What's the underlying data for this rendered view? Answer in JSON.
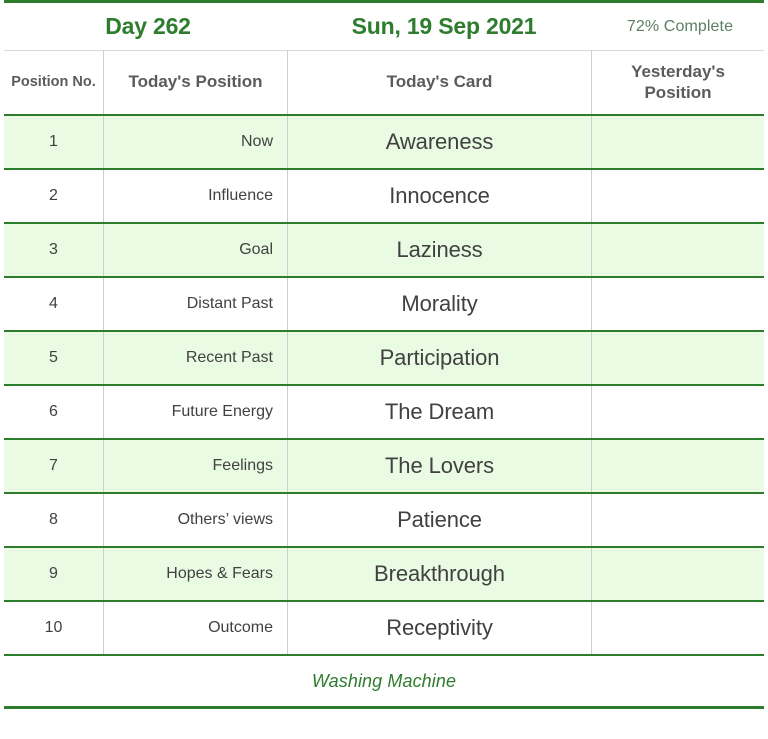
{
  "header": {
    "day_label": "Day 262",
    "date_label": "Sun, 19 Sep 2021",
    "progress_label": "72% Complete"
  },
  "table": {
    "columns": [
      {
        "key": "position_no",
        "label": "Position No."
      },
      {
        "key": "todays_position",
        "label": "Today's Position"
      },
      {
        "key": "todays_card",
        "label": "Today's Card"
      },
      {
        "key": "yesterdays_position",
        "label": "Yesterday's Position"
      }
    ],
    "rows": [
      {
        "no": "1",
        "position": "Now",
        "card": "Awareness",
        "yesterday": ""
      },
      {
        "no": "2",
        "position": "Influence",
        "card": "Innocence",
        "yesterday": ""
      },
      {
        "no": "3",
        "position": "Goal",
        "card": "Laziness",
        "yesterday": ""
      },
      {
        "no": "4",
        "position": "Distant Past",
        "card": "Morality",
        "yesterday": ""
      },
      {
        "no": "5",
        "position": "Recent Past",
        "card": "Participation",
        "yesterday": ""
      },
      {
        "no": "6",
        "position": "Future Energy",
        "card": "The Dream",
        "yesterday": ""
      },
      {
        "no": "7",
        "position": "Feelings",
        "card": "The Lovers",
        "yesterday": ""
      },
      {
        "no": "8",
        "position": "Others’ views",
        "card": "Patience",
        "yesterday": ""
      },
      {
        "no": "9",
        "position": "Hopes & Fears",
        "card": "Breakthrough",
        "yesterday": ""
      },
      {
        "no": "10",
        "position": "Outcome",
        "card": "Receptivity",
        "yesterday": ""
      }
    ]
  },
  "footer": {
    "label": "Washing Machine"
  },
  "colors": {
    "green_accent": "#2e7d2e",
    "row_tint": "#eafbe3",
    "text_dark": "#414141",
    "text_header": "#5b5b5b",
    "text_muted_green": "#5d7f63",
    "divider_gray": "#cfcfcf"
  }
}
